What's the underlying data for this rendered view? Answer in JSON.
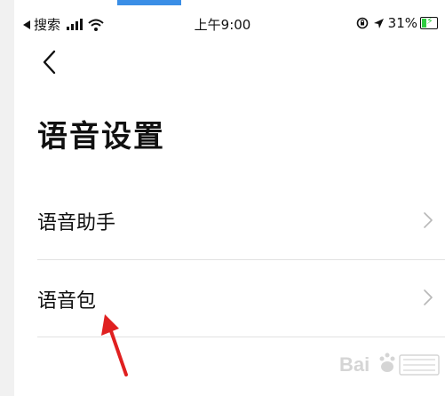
{
  "status_bar": {
    "back_app": "搜索",
    "time": "上午9:00",
    "battery_percent": "31%"
  },
  "icons": {
    "signal": "signal-icon",
    "wifi": "wifi-icon",
    "orientation_lock": "orientation-lock-icon",
    "location": "location-icon",
    "battery": "battery-charging-icon",
    "back": "back-chevron-icon",
    "chevron": "chevron-right-icon"
  },
  "page": {
    "title": "语音设置"
  },
  "settings": {
    "items": [
      {
        "label": "语音助手"
      },
      {
        "label": "语音包"
      }
    ]
  },
  "colors": {
    "annotation_arrow": "#e02020",
    "battery_fill": "#2ecc40",
    "divider": "#e2e2e2"
  }
}
